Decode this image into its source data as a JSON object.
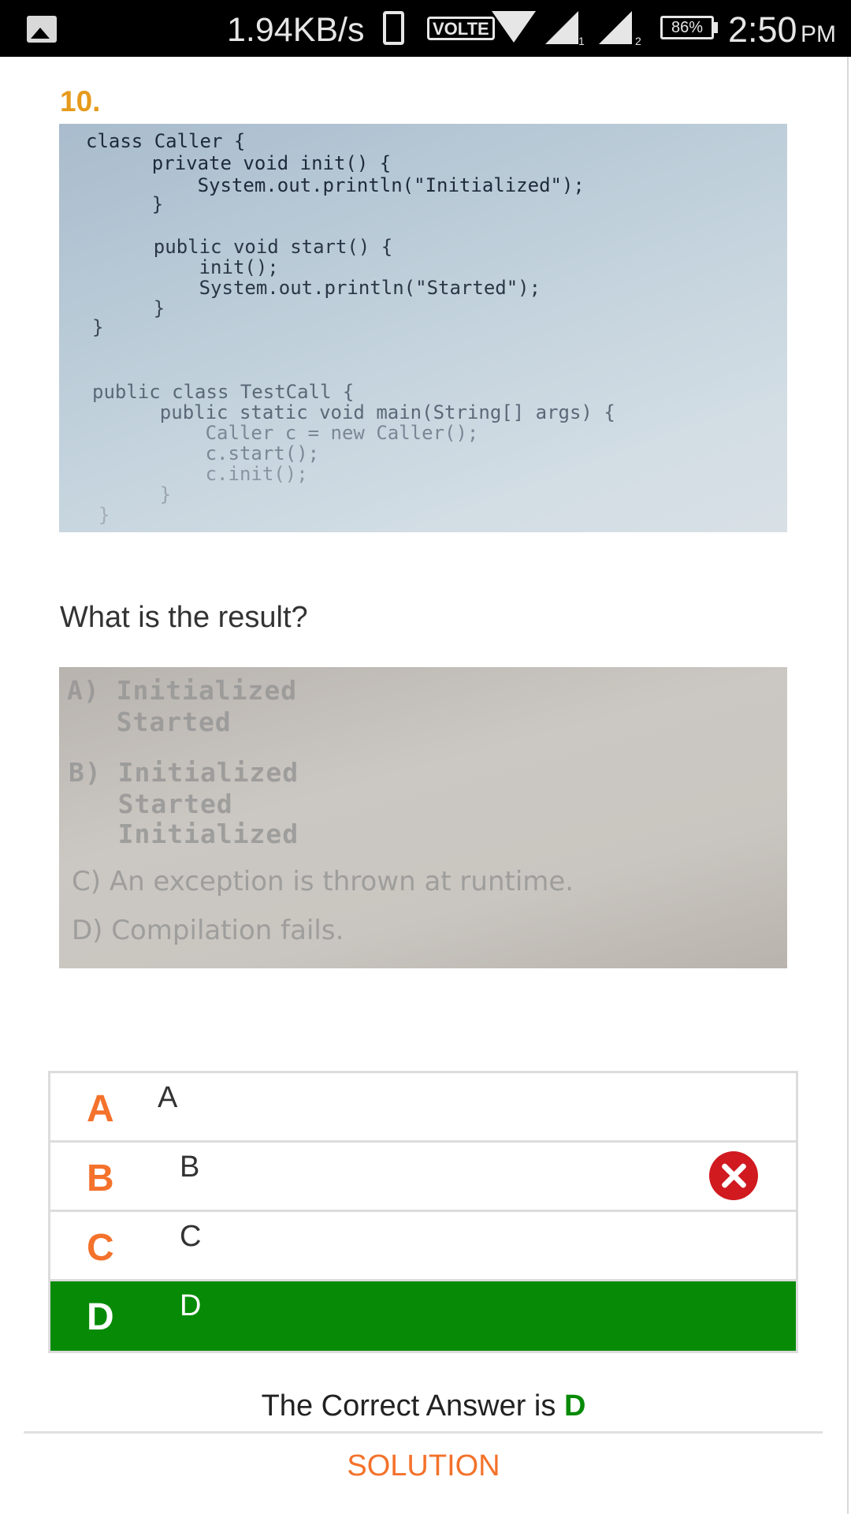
{
  "status_bar": {
    "speed": "1.94KB/s",
    "volte": "VOLTE",
    "sim1": "1",
    "sim2": "2",
    "battery": "86%",
    "time": "2:50",
    "ampm": "PM",
    "icons": [
      "gallery-icon",
      "phone-icon",
      "wifi-icon",
      "signal-icon",
      "signal-icon",
      "battery-icon"
    ]
  },
  "question": {
    "number": "10.",
    "code_lines": [
      "class Caller {",
      "    private void init() {",
      "        System.out.println(\"Initialized\");",
      "    }",
      "    public void start() {",
      "        init();",
      "        System.out.println(\"Started\");",
      "    }",
      "}",
      "public class TestCall {",
      "    public static void main(String[] args) {",
      "        Caller c = new Caller();",
      "        c.start();",
      "        c.init();",
      "    }",
      "}"
    ],
    "prompt": "What is the result?",
    "choices_lines": [
      "A) Initialized",
      "   Started",
      "B) Initialized",
      "   Started",
      "   Initialized",
      "C) An exception is thrown at runtime.",
      "D) Compilation fails."
    ]
  },
  "options": [
    {
      "letter": "A",
      "text": "A",
      "state": "normal"
    },
    {
      "letter": "B",
      "text": "B",
      "state": "wrong"
    },
    {
      "letter": "C",
      "text": "C",
      "state": "normal"
    },
    {
      "letter": "D",
      "text": "D",
      "state": "correct"
    }
  ],
  "result": {
    "prefix": "The Correct Answer is ",
    "answer": "D"
  },
  "solution_label": "SOLUTION",
  "colors": {
    "question_number": "#e69a1c",
    "option_letter": "#f4722b",
    "correct_bg": "#078b07",
    "wrong_icon": "#d01a20",
    "solution": "#f4722b"
  }
}
